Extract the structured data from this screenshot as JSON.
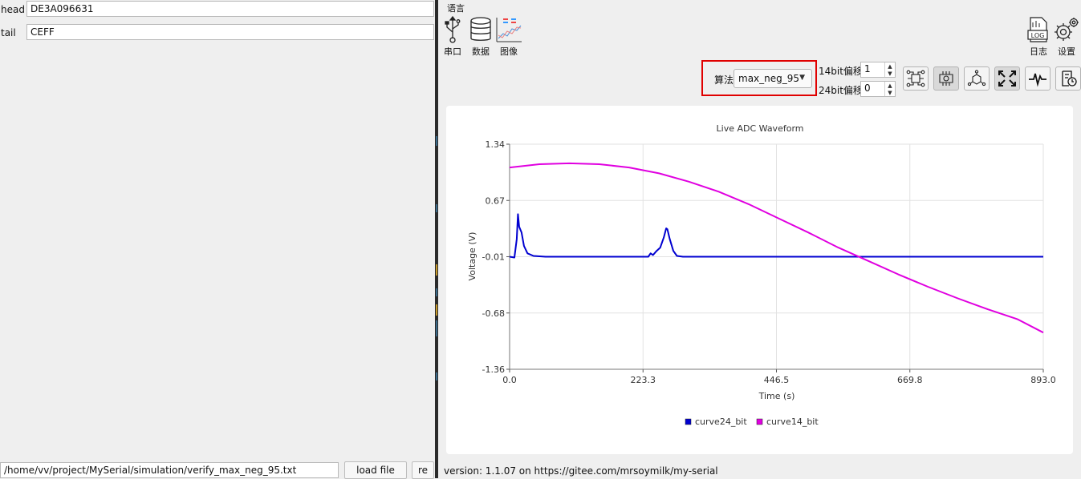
{
  "left": {
    "head_label": "head",
    "head_value": "DE3A096631",
    "tail_label": "tail",
    "tail_value": "CEFF",
    "file_path": "/home/vv/project/MySerial/simulation/verify_max_neg_95.txt",
    "load_button": "load file",
    "re_button": "re"
  },
  "menu": {
    "language": "语言"
  },
  "toolbar": {
    "serial": "串口",
    "data": "数据",
    "image": "图像",
    "log": "日志",
    "settings": "设置"
  },
  "controls": {
    "algorithm_label": "算法",
    "algorithm_value": "max_neg_95",
    "offset14_label": "14bit偏移",
    "offset14_value": "1",
    "offset24_label": "24bit偏移",
    "offset24_value": "0"
  },
  "status": {
    "version": "version: 1.1.07 on https://gitee.com/mrsoymilk/my-serial"
  },
  "colors": {
    "highlight": "#e00000",
    "curve24": "#0000d0",
    "curve14": "#e000e0"
  },
  "chart_data": {
    "type": "line",
    "title": "Live ADC Waveform",
    "xlabel": "Time (s)",
    "ylabel": "Voltage (V)",
    "xlim": [
      0.0,
      893.0
    ],
    "ylim": [
      -1.36,
      1.34
    ],
    "x_ticks": [
      "0.0",
      "223.3",
      "446.5",
      "669.8",
      "893.0"
    ],
    "y_ticks": [
      "1.34",
      "0.67",
      "-0.01",
      "-0.68",
      "-1.36"
    ],
    "grid": true,
    "legend": "bottom-center",
    "series": [
      {
        "name": "curve24_bit",
        "color": "#0000d0",
        "x": [
          0,
          8,
          12,
          14,
          16,
          20,
          24,
          30,
          40,
          60,
          100,
          160,
          220,
          232,
          236,
          240,
          246,
          252,
          258,
          262,
          264,
          268,
          274,
          280,
          290,
          310,
          400,
          600,
          893
        ],
        "y": [
          -0.01,
          -0.02,
          0.2,
          0.5,
          0.35,
          0.28,
          0.12,
          0.03,
          0.0,
          -0.01,
          -0.01,
          -0.01,
          -0.01,
          -0.01,
          0.03,
          0.01,
          0.06,
          0.1,
          0.22,
          0.33,
          0.32,
          0.2,
          0.06,
          0.0,
          -0.01,
          -0.01,
          -0.01,
          -0.01,
          -0.01
        ]
      },
      {
        "name": "curve14_bit",
        "color": "#e000e0",
        "x": [
          0,
          50,
          100,
          150,
          200,
          250,
          300,
          350,
          400,
          450,
          500,
          550,
          600,
          650,
          700,
          750,
          800,
          850,
          893
        ],
        "y": [
          1.06,
          1.1,
          1.11,
          1.1,
          1.06,
          0.99,
          0.89,
          0.77,
          0.62,
          0.45,
          0.28,
          0.1,
          -0.06,
          -0.22,
          -0.37,
          -0.51,
          -0.64,
          -0.76,
          -0.92
        ]
      }
    ]
  }
}
